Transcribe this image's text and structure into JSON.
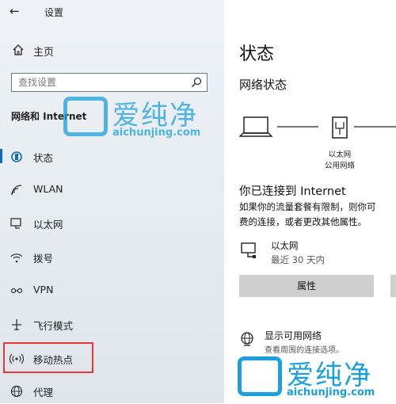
{
  "window": {
    "back_icon": "back-arrow-icon",
    "title": "设置"
  },
  "sidebar": {
    "home_label": "主页",
    "search_placeholder": "查找设置",
    "section_title": "网络和 Internet",
    "items": [
      {
        "label": "状态",
        "icon": "status-icon",
        "selected": true
      },
      {
        "label": "WLAN",
        "icon": "wifi-icon",
        "selected": false
      },
      {
        "label": "以太网",
        "icon": "ethernet-icon",
        "selected": false
      },
      {
        "label": "拨号",
        "icon": "dialup-icon",
        "selected": false
      },
      {
        "label": "VPN",
        "icon": "vpn-icon",
        "selected": false
      },
      {
        "label": "飞行模式",
        "icon": "airplane-icon",
        "selected": false
      },
      {
        "label": "移动热点",
        "icon": "hotspot-icon",
        "selected": false,
        "highlighted": true
      },
      {
        "label": "代理",
        "icon": "globe-icon",
        "selected": false
      }
    ]
  },
  "main": {
    "title": "状态",
    "network_status_title": "网络状态",
    "diagram": {
      "router_caption_1": "以太网",
      "router_caption_2": "公用网络"
    },
    "connected_title": "你已连接到 Internet",
    "description_line1": "如果你的流量套餐有限制，则你可",
    "description_line2": "费的连接，或者更改其他属性。",
    "ethernet": {
      "name": "以太网",
      "usage": "最近 30 天内"
    },
    "properties_button": "属性",
    "show_networks": {
      "title": "显示可用网络",
      "subtitle": "查看周围的连接选项。"
    }
  },
  "watermark": {
    "text": "爱纯净",
    "url": "aichunjing.com"
  },
  "colors": {
    "accent": "#0f6cbd",
    "highlight": "#e53935",
    "watermark": "#1aa0e0"
  }
}
